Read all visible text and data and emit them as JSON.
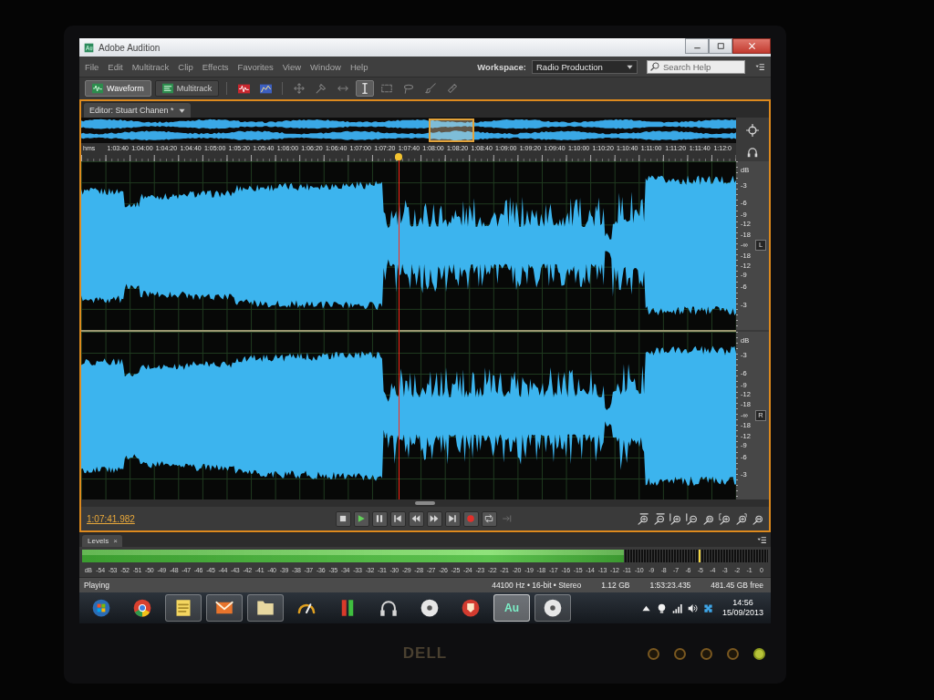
{
  "window": {
    "title": "Adobe Audition"
  },
  "menu": [
    "File",
    "Edit",
    "Multitrack",
    "Clip",
    "Effects",
    "Favorites",
    "View",
    "Window",
    "Help"
  ],
  "workspace": {
    "label": "Workspace:",
    "value": "Radio Production"
  },
  "search": {
    "placeholder": "Search Help"
  },
  "view_tabs": [
    {
      "kind": "waveform",
      "label": "Waveform",
      "selected": true
    },
    {
      "kind": "multitrack",
      "label": "Multitrack",
      "selected": false
    }
  ],
  "tools": [
    {
      "kind": "move",
      "selected": false
    },
    {
      "kind": "razor",
      "selected": false
    },
    {
      "kind": "slip",
      "selected": false
    },
    {
      "kind": "time-selection",
      "selected": true
    },
    {
      "kind": "marquee",
      "selected": false
    },
    {
      "kind": "lasso",
      "selected": false
    },
    {
      "kind": "brush",
      "selected": false
    },
    {
      "kind": "spot-healing",
      "selected": false
    }
  ],
  "editor": {
    "tab": "Editor: Stuart Chanen *"
  },
  "ruler": {
    "labels": [
      "hms",
      "1:03:40",
      "1:04:00",
      "1:04:20",
      "1:04:40",
      "1:05:00",
      "1:05:20",
      "1:05:40",
      "1:06:00",
      "1:06:20",
      "1:06:40",
      "1:07:00",
      "1:07:20",
      "1:07:40",
      "1:08:00",
      "1:08:20",
      "1:08:40",
      "1:09:00",
      "1:09:20",
      "1:09:40",
      "1:10:00",
      "1:10:20",
      "1:10:40",
      "1:11:00",
      "1:11:20",
      "1:11:40",
      "1:12:0"
    ]
  },
  "channels": [
    {
      "name": "L",
      "scale": [
        "dB",
        "-3",
        "-6",
        "-9",
        "-12",
        "-18",
        "-∞",
        "-18",
        "-12",
        "-9",
        "-6",
        "-3"
      ]
    },
    {
      "name": "R",
      "scale": [
        "dB",
        "-3",
        "-6",
        "-9",
        "-12",
        "-18",
        "-∞",
        "-18",
        "-12",
        "-9",
        "-6",
        "-3"
      ]
    }
  ],
  "transport": {
    "time": "1:07:41.982",
    "buttons": [
      {
        "kind": "stop",
        "disabled": false
      },
      {
        "kind": "play",
        "disabled": false
      },
      {
        "kind": "pause",
        "disabled": false
      },
      {
        "kind": "go-to-start",
        "disabled": false
      },
      {
        "kind": "rewind",
        "disabled": false
      },
      {
        "kind": "fast-forward",
        "disabled": false
      },
      {
        "kind": "go-to-end",
        "disabled": false
      },
      {
        "kind": "record",
        "disabled": false
      },
      {
        "kind": "loop",
        "disabled": false
      },
      {
        "kind": "skip-selection",
        "disabled": true
      }
    ]
  },
  "levels": {
    "tab": "Levels",
    "close": "×",
    "meter": {
      "level": 0.79
    },
    "peak_hold": {
      "level": 0.9
    },
    "scale": [
      "dB",
      "-54",
      "-53",
      "-52",
      "-51",
      "-50",
      "-49",
      "-48",
      "-47",
      "-46",
      "-45",
      "-44",
      "-43",
      "-42",
      "-41",
      "-40",
      "-39",
      "-38",
      "-37",
      "-36",
      "-35",
      "-34",
      "-33",
      "-32",
      "-31",
      "-30",
      "-29",
      "-28",
      "-27",
      "-26",
      "-25",
      "-24",
      "-23",
      "-22",
      "-21",
      "-20",
      "-19",
      "-18",
      "-17",
      "-16",
      "-15",
      "-14",
      "-13",
      "-12",
      "-11",
      "-10",
      "-9",
      "-8",
      "-7",
      "-6",
      "-5",
      "-4",
      "-3",
      "-2",
      "-1",
      "0"
    ]
  },
  "status": {
    "state": "Playing",
    "format": "44100 Hz • 16-bit • Stereo",
    "size": "1.12 GB",
    "duration": "1:53:23.435",
    "free": "481.45 GB free"
  },
  "taskbar": {
    "items": [
      {
        "kind": "start",
        "open": false,
        "selected": false
      },
      {
        "kind": "browser",
        "open": false,
        "selected": false
      },
      {
        "kind": "note",
        "open": true,
        "selected": false
      },
      {
        "kind": "envelope",
        "open": true,
        "selected": false
      },
      {
        "kind": "folder",
        "open": true,
        "selected": false
      },
      {
        "kind": "gauge",
        "open": false,
        "selected": false
      },
      {
        "kind": "level-bars",
        "open": false,
        "selected": false
      },
      {
        "kind": "headphones",
        "open": false,
        "selected": false
      },
      {
        "kind": "disc",
        "open": false,
        "selected": false
      },
      {
        "kind": "shield",
        "open": false,
        "selected": false
      },
      {
        "kind": "app-tile",
        "label": "Au",
        "open": true,
        "selected": true
      },
      {
        "kind": "disc",
        "open": true,
        "selected": false
      }
    ],
    "time": "14:56",
    "date": "15/09/2013"
  },
  "monitor": {
    "brand": "DELL"
  }
}
